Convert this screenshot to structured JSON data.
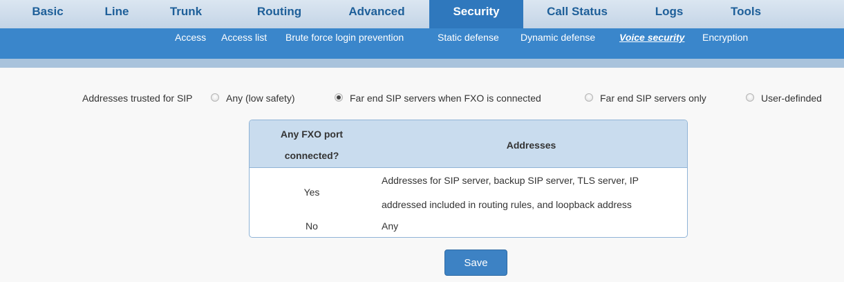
{
  "topnav": {
    "tabs": [
      "Basic",
      "Line",
      "Trunk",
      "Routing",
      "Advanced",
      "Security",
      "Call Status",
      "Logs",
      "Tools"
    ],
    "active_tab": "Security"
  },
  "subnav": {
    "items": [
      "Access",
      "Access list",
      "Brute force login prevention",
      "Static defense",
      "Dynamic defense",
      "Voice security",
      "Encryption"
    ],
    "active_item": "Voice security"
  },
  "trusted": {
    "label": "Addresses trusted for SIP",
    "options": [
      "Any (low safety)",
      "Far end SIP servers when FXO is connected",
      "Far end SIP servers only",
      "User-definded"
    ],
    "selected": "Far end SIP servers when FXO is connected"
  },
  "table": {
    "headers": [
      "Any FXO port",
      "connected?",
      "Addresses"
    ],
    "rows": [
      {
        "connected": "Yes",
        "address_line1": "Addresses for SIP server, backup SIP server, TLS server, IP",
        "address_line2": "addressed included in routing rules, and loopback address"
      },
      {
        "connected": "No",
        "address_line1": "Any"
      }
    ]
  },
  "save_label": "Save"
}
